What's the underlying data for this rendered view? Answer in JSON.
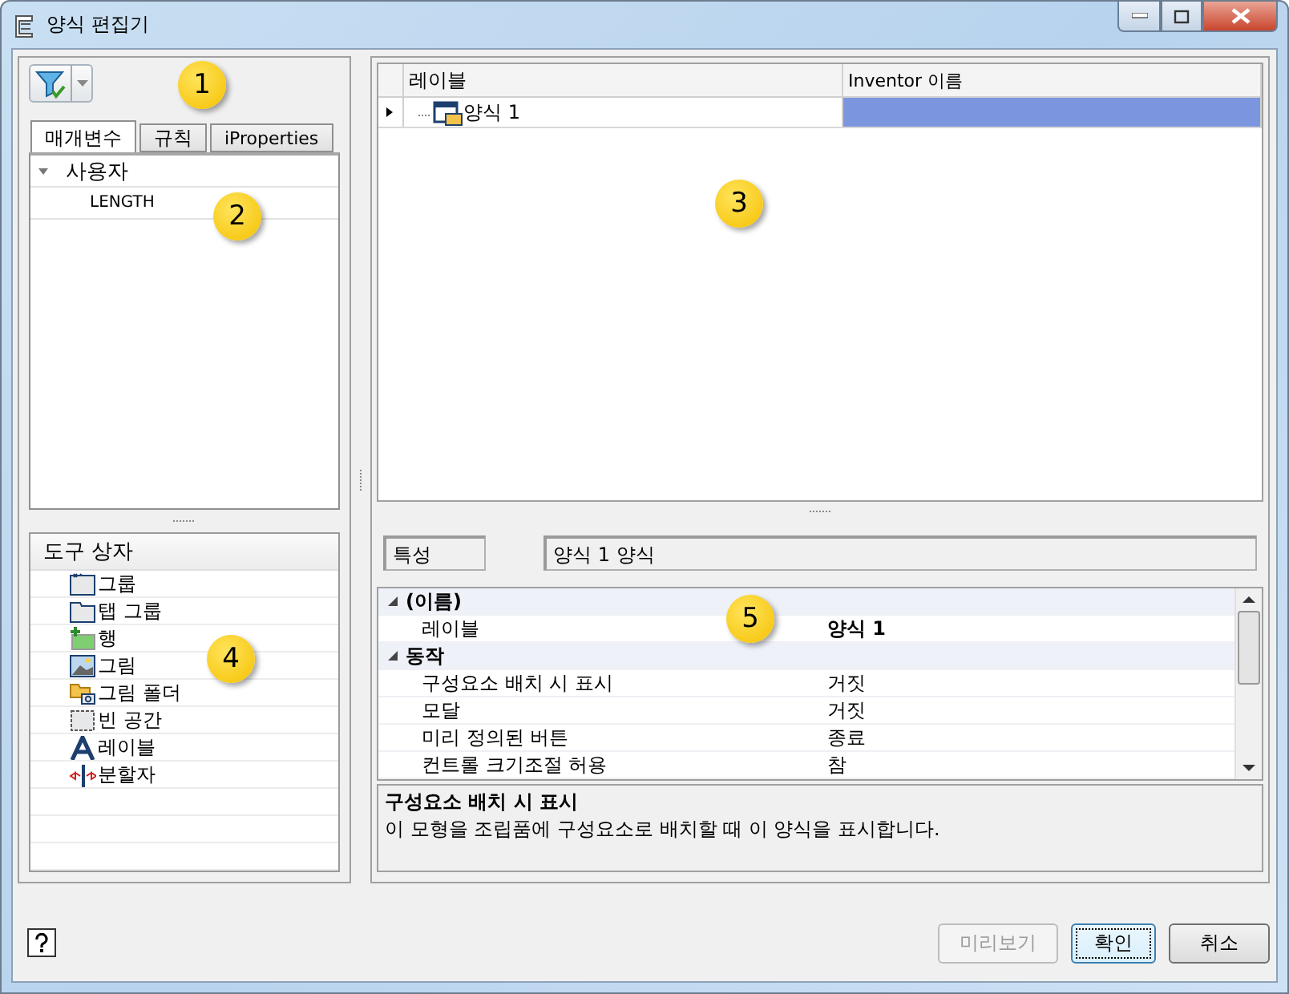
{
  "window": {
    "title": "양식 편집기"
  },
  "tabs": [
    {
      "label": "매개변수",
      "selected": true
    },
    {
      "label": "규칙",
      "selected": false
    },
    {
      "label": "iProperties",
      "selected": false
    }
  ],
  "parameter_tree": [
    {
      "label": "사용자",
      "expanded": true,
      "children": [
        {
          "label": "LENGTH"
        }
      ]
    }
  ],
  "form_table": {
    "columns": [
      "레이블",
      "Inventor 이름"
    ],
    "rows": [
      {
        "label": "양식 1",
        "selected": true
      }
    ]
  },
  "toolbox": {
    "title": "도구 상자",
    "items": [
      {
        "label": "그룹",
        "kind": "group"
      },
      {
        "label": "탭 그룹",
        "kind": "tabgroup"
      },
      {
        "label": "행",
        "kind": "row"
      },
      {
        "label": "그림",
        "kind": "picture"
      },
      {
        "label": "그림 폴더",
        "kind": "folder"
      },
      {
        "label": "빈 공간",
        "kind": "space"
      },
      {
        "label": "레이블",
        "kind": "label"
      },
      {
        "label": "분할자",
        "kind": "splitter"
      }
    ]
  },
  "properties_header": {
    "label": "특성",
    "value": "양식 1 양식"
  },
  "property_grid": [
    {
      "name": "(이름)",
      "expanded": true,
      "properties": [
        {
          "name": "레이블",
          "value": "양식 1",
          "modified": true
        }
      ]
    },
    {
      "name": "동작",
      "expanded": true,
      "properties": [
        {
          "name": "구성요소 배치 시 표시",
          "value": "거짓",
          "modified": false
        },
        {
          "name": "모달",
          "value": "거짓",
          "modified": false
        },
        {
          "name": "미리 정의된 버튼",
          "value": "종료",
          "modified": false
        },
        {
          "name": "컨트롤 크기조절 허용",
          "value": "참",
          "modified": false
        }
      ]
    }
  ],
  "description": {
    "title": "구성요소 배치 시 표시",
    "text": "이 모형을 조립품에 구성요소로 배치할 때 이 양식을 표시합니다."
  },
  "buttons": [
    {
      "label": "미리보기",
      "disabled": true,
      "default": false
    },
    {
      "label": "확인",
      "disabled": false,
      "default": true
    },
    {
      "label": "취소",
      "disabled": false,
      "default": false
    }
  ],
  "callouts": [
    "1",
    "2",
    "3",
    "4",
    "5"
  ]
}
